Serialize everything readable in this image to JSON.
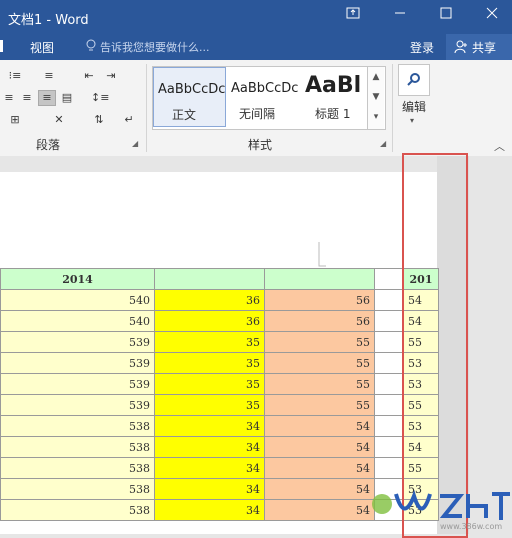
{
  "window": {
    "title": "文档1 - Word"
  },
  "tabs": {
    "view": "视图",
    "tell_me": "告诉我您想要做什么...",
    "login": "登录",
    "share": "共享"
  },
  "ribbon": {
    "groups": {
      "paragraph": "段落",
      "styles": "样式",
      "editing": "编辑"
    },
    "styles": [
      {
        "sample": "AaBbCcDc",
        "name": "正文"
      },
      {
        "sample": "AaBbCcDc",
        "name": "无间隔"
      },
      {
        "sample": "AaBl",
        "name": "标题 1"
      }
    ]
  },
  "table": {
    "header": [
      "2014",
      "",
      "",
      "",
      "201"
    ],
    "rows": [
      [
        "540",
        "36",
        "56",
        "",
        "54"
      ],
      [
        "540",
        "36",
        "56",
        "",
        "54"
      ],
      [
        "539",
        "35",
        "55",
        "",
        "55"
      ],
      [
        "539",
        "35",
        "55",
        "",
        "53"
      ],
      [
        "539",
        "35",
        "55",
        "",
        "53"
      ],
      [
        "539",
        "35",
        "55",
        "",
        "55"
      ],
      [
        "538",
        "34",
        "54",
        "",
        "53"
      ],
      [
        "538",
        "34",
        "54",
        "",
        "54"
      ],
      [
        "538",
        "34",
        "54",
        "",
        "55"
      ],
      [
        "538",
        "34",
        "54",
        "",
        "53"
      ],
      [
        "538",
        "34",
        "54",
        "",
        "53"
      ]
    ]
  },
  "watermark": {
    "text": "www.386w.com"
  },
  "colors": {
    "word_blue": "#2b579a",
    "highlight_box": "#d9534f"
  }
}
